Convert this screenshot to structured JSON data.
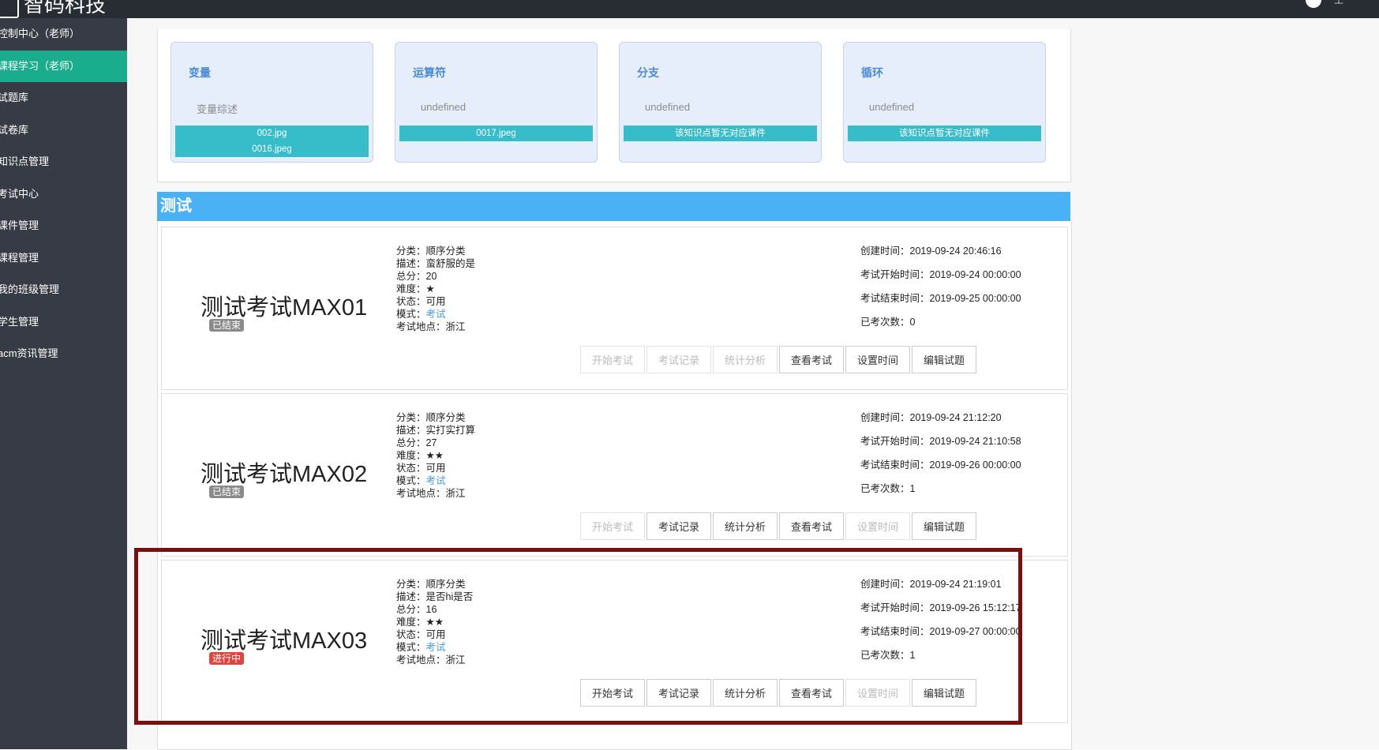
{
  "app": {
    "brand": "智码科技",
    "user": "王"
  },
  "sidebar": {
    "items": [
      {
        "label": "控制中心（老师）",
        "active": false
      },
      {
        "label": "课程学习（老师）",
        "active": true
      },
      {
        "label": "试题库",
        "active": false
      },
      {
        "label": "试卷库",
        "active": false
      },
      {
        "label": "知识点管理",
        "active": false
      },
      {
        "label": "考试中心",
        "active": false
      },
      {
        "label": "课件管理",
        "active": false
      },
      {
        "label": "课程管理",
        "active": false
      },
      {
        "label": "我的班级管理",
        "active": false
      },
      {
        "label": "学生管理",
        "active": false
      },
      {
        "label": "acm资讯管理",
        "active": false
      }
    ]
  },
  "knowledge_points": [
    {
      "title": "变量",
      "desc": "变量综述",
      "files": [
        "002.jpg",
        "0016.jpeg"
      ]
    },
    {
      "title": "运算符",
      "desc": "undefined",
      "files": [
        "0017.jpeg"
      ]
    },
    {
      "title": "分支",
      "desc": "undefined",
      "files": [
        "该知识点暂无对应课件"
      ]
    },
    {
      "title": "循环",
      "desc": "undefined",
      "files": [
        "该知识点暂无对应课件"
      ]
    }
  ],
  "test_section": {
    "title": "测试"
  },
  "labels": {
    "category": "分类：",
    "description": "描述：",
    "total": "总分：",
    "difficulty": "难度：",
    "status": "状态：",
    "mode": "模式：",
    "location": "考试地点：",
    "created": "创建时间：",
    "start": "考试开始时间：",
    "end": "考试结束时间：",
    "attempts": "已考次数："
  },
  "buttons": {
    "start_exam": "开始考试",
    "records": "考试记录",
    "stats": "统计分析",
    "view": "查看考试",
    "set_time": "设置时间",
    "edit_questions": "编辑试题"
  },
  "exams": [
    {
      "name": "测试考试MAX01",
      "badge": "已结束",
      "category": "顺序分类",
      "description": "蛮舒服的是",
      "total": "20",
      "difficulty": "★",
      "status": "可用",
      "mode": "考试",
      "location": "浙江",
      "created": "2019-09-24 20:46:16",
      "start": "2019-09-24 00:00:00",
      "end": "2019-09-25 00:00:00",
      "attempts": "0"
    },
    {
      "name": "测试考试MAX02",
      "badge": "已结束",
      "category": "顺序分类",
      "description": "实打实打算",
      "total": "27",
      "difficulty": "★★",
      "status": "可用",
      "mode": "考试",
      "location": "浙江",
      "created": "2019-09-24 21:12:20",
      "start": "2019-09-24 21:10:58",
      "end": "2019-09-26 00:00:00",
      "attempts": "1"
    },
    {
      "name": "测试考试MAX03",
      "badge": "进行中",
      "category": "顺序分类",
      "description": "是否hi是否",
      "total": "16",
      "difficulty": "★★",
      "status": "可用",
      "mode": "考试",
      "location": "浙江",
      "created": "2019-09-24 21:19:01",
      "start": "2019-09-26 15:12:17",
      "end": "2019-09-27 00:00:00",
      "attempts": "1"
    }
  ],
  "colors": {
    "sidebar_bg": "#363b45",
    "sidebar_active": "#1aad8d",
    "card_bg": "#e6eefc",
    "file_bar": "#37bcc9",
    "section_header": "#4ab2f4",
    "badge_ended": "#8a8a8a",
    "badge_ongoing": "#e0443c",
    "highlight_border": "#7a0f0f"
  }
}
